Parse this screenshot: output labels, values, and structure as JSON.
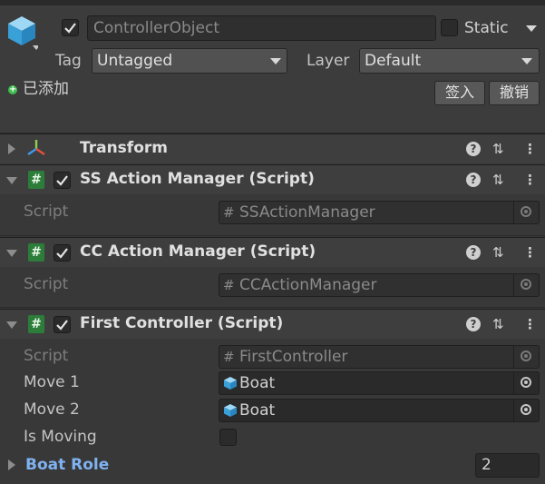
{
  "header": {
    "object_name": "ControllerObject",
    "static_label": "Static",
    "tag_label": "Tag",
    "tag_value": "Untagged",
    "layer_label": "Layer",
    "layer_value": "Default",
    "added_text": "已添加",
    "sign_in_button": "签入",
    "undo_button": "撤销"
  },
  "components": [
    {
      "title": "Transform"
    },
    {
      "title": "SS Action Manager (Script)",
      "script_label": "Script",
      "script_value": "SSActionManager"
    },
    {
      "title": "CC Action Manager (Script)",
      "script_label": "Script",
      "script_value": "CCActionManager"
    },
    {
      "title": "First Controller (Script)",
      "script_label": "Script",
      "script_value": "FirstController",
      "fields": {
        "move1_label": "Move 1",
        "move1_value": "Boat",
        "move2_label": "Move 2",
        "move2_value": "Boat",
        "is_moving_label": "Is Moving",
        "boat_role_label": "Boat Role",
        "boat_role_value": "2"
      }
    }
  ],
  "colors": {
    "script_icon": "#2d7d3a",
    "boat_role_label": "#7fb2f0",
    "added_dot": "#3fbf4f"
  }
}
